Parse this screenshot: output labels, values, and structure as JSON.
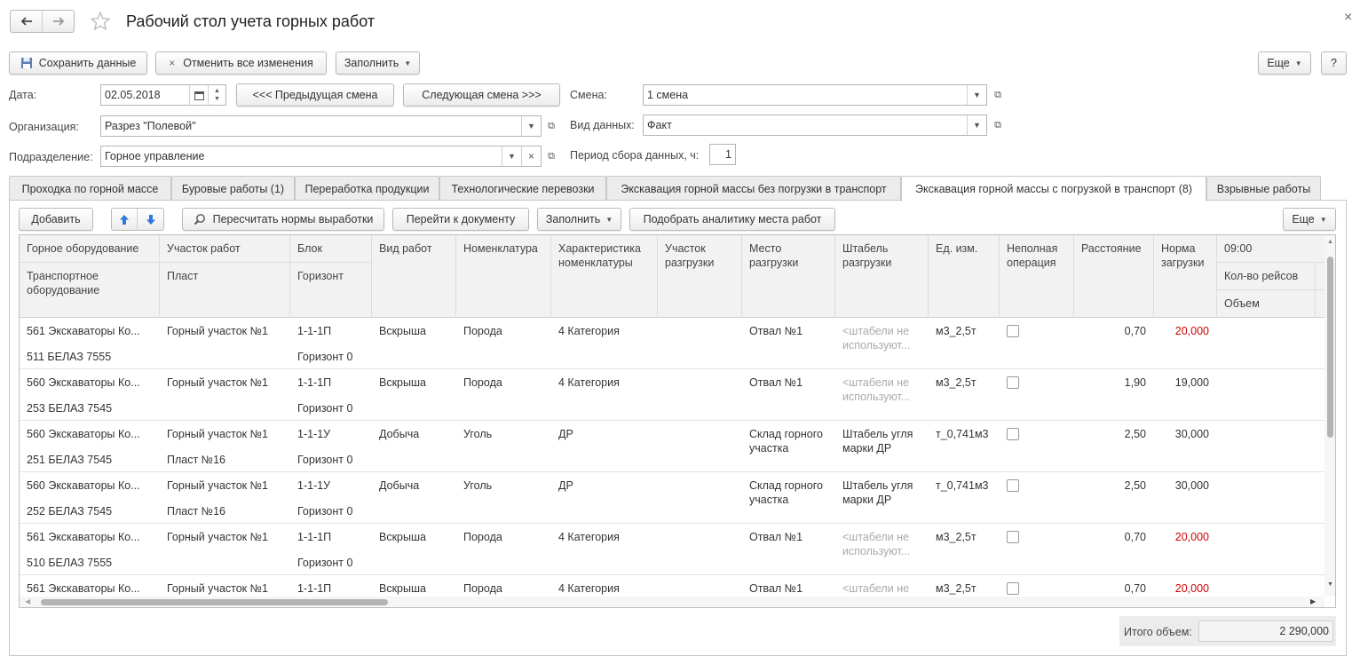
{
  "window": {
    "title": "Рабочий стол учета горных работ",
    "close": "×"
  },
  "toolbar": {
    "save": "Сохранить данные",
    "cancel": "Отменить все изменения",
    "fill": "Заполнить",
    "more": "Еще",
    "help": "?"
  },
  "form": {
    "date_label": "Дата:",
    "date_value": "02.05.2018",
    "prev_shift": "<<< Предыдущая смена",
    "next_shift": "Следующая смена >>>",
    "shift_label": "Смена:",
    "shift_value": "1 смена",
    "org_label": "Организация:",
    "org_value": "Разрез \"Полевой\"",
    "datatype_label": "Вид данных:",
    "datatype_value": "Факт",
    "dept_label": "Подразделение:",
    "dept_value": "Горное управление",
    "period_label": "Период сбора данных, ч:",
    "period_value": "1"
  },
  "tabs": [
    "Проходка по горной массе",
    "Буровые работы (1)",
    "Переработка продукции",
    "Технологические перевозки",
    "Экскавация горной массы без погрузки в транспорт",
    "Экскавация горной массы с погрузкой в транспорт (8)",
    "Взрывные работы"
  ],
  "active_tab": 5,
  "table_toolbar": {
    "add": "Добавить",
    "recalc": "Пересчитать нормы выработки",
    "goto_doc": "Перейти к документу",
    "fill": "Заполнить",
    "pick": "Подобрать аналитику места работ",
    "more": "Еще"
  },
  "columns": {
    "equipment": "Горное оборудование",
    "transport": "Транспортное оборудование",
    "site": "Участок работ",
    "seam": "Пласт",
    "block": "Блок",
    "horizon": "Горизонт",
    "work_type": "Вид работ",
    "nomenclature": "Номенклатура",
    "characteristic": "Характеристика номенклатуры",
    "load_site": "Участок разгрузки",
    "unload_place": "Место разгрузки",
    "stack": "Штабель разгрузки",
    "unit": "Ед. изм.",
    "partial": "Неполная операция",
    "distance": "Расстояние",
    "norm": "Норма загрузки",
    "time": "09:00",
    "trips": "Кол-во рейсов",
    "volume": "Объем"
  },
  "rows": [
    {
      "equipment": "561 Экскаваторы Ко...",
      "transport": "511 БЕЛАЗ 7555",
      "site": "Горный участок №1",
      "seam": "",
      "block": "1-1-1П",
      "horizon": "Горизонт 0",
      "work_type": "Вскрыша",
      "nomenclature": "Порода",
      "characteristic": "4 Категория",
      "load_site": "",
      "unload_place": "Отвал №1",
      "stack": "<штабели не используют...",
      "unit": "м3_2,5т",
      "distance": "0,70",
      "norm": "20,000",
      "norm_red": true
    },
    {
      "equipment": "560 Экскаваторы Ко...",
      "transport": "253 БЕЛАЗ 7545",
      "site": "Горный участок №1",
      "seam": "",
      "block": "1-1-1П",
      "horizon": "Горизонт 0",
      "work_type": "Вскрыша",
      "nomenclature": "Порода",
      "characteristic": "4 Категория",
      "load_site": "",
      "unload_place": "Отвал №1",
      "stack": "<штабели не используют...",
      "unit": "м3_2,5т",
      "distance": "1,90",
      "norm": "19,000",
      "norm_red": false
    },
    {
      "equipment": "560 Экскаваторы Ко...",
      "transport": "251 БЕЛАЗ 7545",
      "site": "Горный участок №1",
      "seam": "Пласт №16",
      "block": "1-1-1У",
      "horizon": "Горизонт 0",
      "work_type": "Добыча",
      "nomenclature": "Уголь",
      "characteristic": "ДР",
      "load_site": "",
      "unload_place": "Склад горного участка",
      "stack": "Штабель угля марки ДР",
      "unit": "т_0,741м3",
      "distance": "2,50",
      "norm": "30,000",
      "norm_red": false
    },
    {
      "equipment": "560 Экскаваторы Ко...",
      "transport": "252 БЕЛАЗ 7545",
      "site": "Горный участок №1",
      "seam": "Пласт №16",
      "block": "1-1-1У",
      "horizon": "Горизонт 0",
      "work_type": "Добыча",
      "nomenclature": "Уголь",
      "characteristic": "ДР",
      "load_site": "",
      "unload_place": "Склад горного участка",
      "stack": "Штабель угля марки ДР",
      "unit": "т_0,741м3",
      "distance": "2,50",
      "norm": "30,000",
      "norm_red": false
    },
    {
      "equipment": "561 Экскаваторы Ко...",
      "transport": "510 БЕЛАЗ 7555",
      "site": "Горный участок №1",
      "seam": "",
      "block": "1-1-1П",
      "horizon": "Горизонт 0",
      "work_type": "Вскрыша",
      "nomenclature": "Порода",
      "characteristic": "4 Категория",
      "load_site": "",
      "unload_place": "Отвал №1",
      "stack": "<штабели не используют...",
      "unit": "м3_2,5т",
      "distance": "0,70",
      "norm": "20,000",
      "norm_red": true
    },
    {
      "equipment": "561 Экскаваторы Ко...",
      "transport": "",
      "site": "Горный участок №1",
      "seam": "",
      "block": "1-1-1П",
      "horizon": "",
      "work_type": "Вскрыша",
      "nomenclature": "Порода",
      "characteristic": "4 Категория",
      "load_site": "",
      "unload_place": "Отвал №1",
      "stack": "<штабели не",
      "unit": "м3_2,5т",
      "distance": "0,70",
      "norm": "20,000",
      "norm_red": true
    }
  ],
  "footer": {
    "total_label": "Итого объем:",
    "total_value": "2 290,000"
  },
  "colors": {
    "red": "#d00000",
    "gray_text": "#aaaaaa",
    "blue_arrow": "#2f7ad8"
  }
}
